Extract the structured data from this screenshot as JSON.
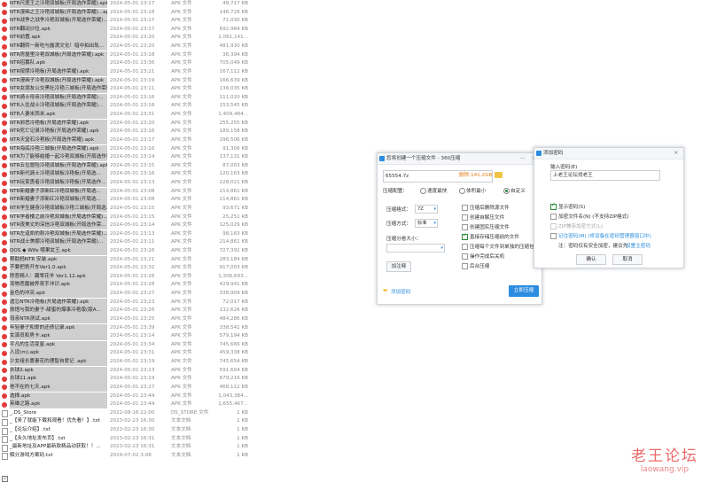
{
  "files": [
    {
      "name": "NTR尺度王之冷艳双城板(开局选作荣耀).apk",
      "date": "2024-05-01 23:17",
      "type": "APK 文件",
      "size": "48,717 KB",
      "icon": "apk"
    },
    {
      "name": "NTR漫画之王冷艳双城板(开局选作荣耀)...apk",
      "date": "2024-05-01 23:18",
      "type": "APK 文件",
      "size": "146,728 KB",
      "icon": "apk"
    },
    {
      "name": "NTR战争之战争冷艳双城板(开局选作荣耀)...",
      "date": "2024-05-01 23:17",
      "type": "APK 文件",
      "size": "71,030 KB",
      "icon": "apk"
    },
    {
      "name": "NTR翻动沙拉.apk",
      "date": "2024-05-01 23:17",
      "type": "APK 文件",
      "size": "692,984 KB",
      "icon": "apk"
    },
    {
      "name": "NTR前置.apk",
      "date": "2024-05-01 23:20",
      "type": "APK 文件",
      "size": "1,061,141...",
      "icon": "apk"
    },
    {
      "name": "NTR翻转一新吃与露滴文化！暗中拍出轨...",
      "date": "2024-05-01 23:20",
      "type": "APK 文件",
      "size": "481,930 KB",
      "icon": "apk"
    },
    {
      "name": "NTR房屋里冷艳双城板(开局选作荣耀).apk",
      "date": "2024-05-01 23:18",
      "type": "APK 文件",
      "size": "36,394 KB",
      "icon": "apk"
    },
    {
      "name": "NTR招募队.apk",
      "date": "2024-05-01 23:36",
      "type": "APK 文件",
      "size": "705,049 KB",
      "icon": "apk"
    },
    {
      "name": "NTR按摩冷艳板(开局选作荣耀).apk",
      "date": "2024-05-01 23:21",
      "type": "APK 文件",
      "size": "167,112 KB",
      "icon": "apk"
    },
    {
      "name": "NTR漫画子冷艳双城板(开局选作荣耀).apk",
      "date": "2024-05-01 23:19",
      "type": "APK 文件",
      "size": "166,639 KB",
      "icon": "apk"
    },
    {
      "name": "NTR女朋友公交黑社冷艳三城板(开局选作荣耀)...",
      "date": "2024-05-01 23:11",
      "type": "APK 文件",
      "size": "136,035 KB",
      "icon": "apk"
    },
    {
      "name": "NTR骑士母亲冷艳双城板(开局选作荣耀)...",
      "date": "2024-05-01 23:16",
      "type": "APK 文件",
      "size": "111,020 KB",
      "icon": "apk"
    },
    {
      "name": "NTR入住战士冷艳双城板(开局选作荣耀)...",
      "date": "2024-05-01 23:18",
      "type": "APK 文件",
      "size": "153,545 KB",
      "icon": "apk"
    },
    {
      "name": "NTR人妻米西米.apk",
      "date": "2024-05-01 23:31",
      "type": "APK 文件",
      "size": "1,409,484...",
      "icon": "apk"
    },
    {
      "name": "NTR邪恶冷艳板(开局选作荣耀).apk",
      "date": "2024-05-01 23:20",
      "type": "APK 文件",
      "size": "255,255 KB",
      "icon": "apk"
    },
    {
      "name": "NTR死亡记录冷艳板(开局选作荣耀).apk",
      "date": "2024-05-01 23:16",
      "type": "APK 文件",
      "size": "189,158 KB",
      "icon": "apk"
    },
    {
      "name": "NTR天堂石冷艳板(开局选作荣耀).apk",
      "date": "2024-05-01 23:17",
      "type": "APK 文件",
      "size": "296,506 KB",
      "icon": "apk"
    },
    {
      "name": "NTR海底冷艳三城板(开局选作荣耀).apk",
      "date": "2024-05-01 23:16",
      "type": "APK 文件",
      "size": "91,306 KB",
      "icon": "apk"
    },
    {
      "name": "NTR为了能够结婚一起冷艳双城板(开局选作荣耀)",
      "date": "2024-05-01 23:14",
      "type": "APK 文件",
      "size": "137,131 KB",
      "icon": "apk"
    },
    {
      "name": "NTR五位冒险冷艳双城板(开局选作荣耀).apk",
      "date": "2024-05-01 23:15",
      "type": "APK 文件",
      "size": "87,003 KB",
      "icon": "apk"
    },
    {
      "name": "NTR新代骑士冷艳双城板冷艳板(开局选...",
      "date": "2024-05-01 23:16",
      "type": "APK 文件",
      "size": "120,163 KB",
      "icon": "apk"
    },
    {
      "name": "NTR玩家勇者冷艳双城板冷艳板(开局选作...",
      "date": "2024-05-01 23:13",
      "type": "APK 文件",
      "size": "228,021 KB",
      "icon": "apk"
    },
    {
      "name": "NTR新婚妻子添新红冷艳双城板(开局选...",
      "date": "2024-05-01 23:08",
      "type": "APK 文件",
      "size": "214,861 KB",
      "icon": "apk"
    },
    {
      "name": "NTR新婚妻子添新红冷艳双城板(开局选...",
      "date": "2024-05-01 23:08",
      "type": "APK 文件",
      "size": "214,861 KB",
      "icon": "apk"
    },
    {
      "name": "NTR学生健身冷艳双城板冷艳三城板(开局选...",
      "date": "2024-05-01 23:15",
      "type": "APK 文件",
      "size": "93,671 KB",
      "icon": "apk"
    },
    {
      "name": "NTR学者楼之前冷艳双城板(开局选作荣耀)...",
      "date": "2024-05-01 23:15",
      "type": "APK 文件",
      "size": "25,251 KB",
      "icon": "apk"
    },
    {
      "name": "NTR夜美丈的深信冷艳双城板(开局选作荣...",
      "date": "2024-05-01 23:14",
      "type": "APK 文件",
      "size": "125,029 KB",
      "icon": "apk"
    },
    {
      "name": "NTR左道凯的刺冷艳双城板(开局选作荣耀)...",
      "date": "2024-05-01 23:13",
      "type": "APK 文件",
      "size": "98,163 KB",
      "icon": "apk"
    },
    {
      "name": "NTR战士美娜冷艳双城板(开局选作荣耀)...",
      "date": "2024-05-01 23:11",
      "type": "APK 文件",
      "size": "214,861 KB",
      "icon": "apk"
    },
    {
      "name": "QOS ◆ Wife 哪果女王.apk",
      "date": "2024-05-01 23:26",
      "type": "APK 文件",
      "size": "727,392 KB",
      "icon": "apk"
    },
    {
      "name": "帮助妈NTR 安装.apk",
      "date": "2024-05-01 23:21",
      "type": "APK 文件",
      "size": "283,184 KB",
      "icon": "apk"
    },
    {
      "name": "不要把男开车Ver1.0.apk",
      "date": "2024-05-01 23:32",
      "type": "APK 文件",
      "size": "917,003 KB",
      "icon": "apk"
    },
    {
      "name": "除恶精人：藏零花羊 Ver1.12.apk",
      "date": "2024-05-01 23:26",
      "type": "APK 文件",
      "size": "1,306,693...",
      "icon": "apk"
    },
    {
      "name": "宠物恶魔被养育手冲识.apk",
      "date": "2024-05-01 23:28",
      "type": "APK 文件",
      "size": "429,941 KB",
      "icon": "apk"
    },
    {
      "name": "金色的冲突.apk",
      "date": "2024-05-01 23:27",
      "type": "APK 文件",
      "size": "338,909 KB",
      "icon": "apk"
    },
    {
      "name": "遗忘NTR冷艳板(开局选作荣耀).apk",
      "date": "2024-05-01 23:23",
      "type": "APK 文件",
      "size": "72,017 KB",
      "icon": "apk"
    },
    {
      "name": "旅馆与我的妻子-甜蜜的爆事冷艳版(版A...",
      "date": "2024-05-01 23:26",
      "type": "APK 文件",
      "size": "132,626 KB",
      "icon": "apk"
    },
    {
      "name": "母亲NTR测试.apk",
      "date": "2024-05-01 23:25",
      "type": "APK 文件",
      "size": "484,286 KB",
      "icon": "apk"
    },
    {
      "name": "年轻妻子和爱的还债记录.apk",
      "date": "2024-05-01 23:39",
      "type": "APK 文件",
      "size": "338,541 KB",
      "icon": "apk"
    },
    {
      "name": "女演员和男卡.apk",
      "date": "2024-05-01 23:14",
      "type": "APK 文件",
      "size": "579,194 KB",
      "icon": "apk"
    },
    {
      "name": "平凡的生活变星.apk",
      "date": "2024-05-01 23:34",
      "type": "APK 文件",
      "size": "745,666 KB",
      "icon": "apk"
    },
    {
      "name": "人设(m).apk",
      "date": "2024-05-01 23:31",
      "type": "APK 文件",
      "size": "459,338 KB",
      "icon": "apk"
    },
    {
      "name": "少女组长寡妻花的理智自爱记 .apk",
      "date": "2024-05-01 23:19",
      "type": "APK 文件",
      "size": "745,654 KB",
      "icon": "apk"
    },
    {
      "name": "水球2.apk",
      "date": "2024-05-01 23:23",
      "type": "APK 文件",
      "size": "591,604 KB",
      "icon": "apk"
    },
    {
      "name": "水球11.apk",
      "date": "2024-05-01 23:19",
      "type": "APK 文件",
      "size": "879,216 KB",
      "icon": "apk"
    },
    {
      "name": "他不在的七天.apk",
      "date": "2024-05-01 23:27",
      "type": "APK 文件",
      "size": "468,112 KB",
      "icon": "apk"
    },
    {
      "name": "选择.apk",
      "date": "2024-05-01 23:44",
      "type": "APK 文件",
      "size": "1,043,384...",
      "icon": "apk"
    },
    {
      "name": "英雄之路.apk",
      "date": "2024-05-01 23:44",
      "type": "APK 文件",
      "size": "1,655,467...",
      "icon": "apk"
    },
    {
      "name": "_.DS_Store",
      "date": "2022-08-16 22:00",
      "type": "DS_STORE 文件",
      "size": "1 KB",
      "icon": "txt"
    },
    {
      "name": "_【来了就能下载和观看！优先看！】.txt",
      "date": "2023-02-23 16:30",
      "type": "文本文档",
      "size": "1 KB",
      "icon": "txt"
    },
    {
      "name": "_【论坛介绍】.txt",
      "date": "2023-02-23 16:30",
      "type": "文本文档",
      "size": "1 KB",
      "icon": "txt"
    },
    {
      "name": "_【永久地址发布页】.txt",
      "date": "2023-02-23 16:31",
      "type": "文本文档",
      "size": "1 KB",
      "icon": "txt"
    },
    {
      "name": "_最新地址及APP最新款精品动获取！！...",
      "date": "2023-02-23 16:31",
      "type": "文本文档",
      "size": "1 KB",
      "icon": "txt"
    },
    {
      "name": "解分游戏方案码.txt",
      "date": "2024-07-02 3:08",
      "type": "文本文档",
      "size": "1 KB",
      "icon": "txt"
    }
  ],
  "zip_dialog": {
    "title": "您将创建一个压缩文件 - 360压缩",
    "filename": "65554.7z",
    "delete_size": "删除:141.2GB",
    "config_label": "压缩配置：",
    "mode_fast": "速度最快",
    "mode_small": "体积最小",
    "mode_custom": "自定义",
    "format_label": "压缩格式：",
    "format_value": "7Z",
    "method_label": "压缩方式：",
    "method_value": "标准",
    "split_label": "压缩分卷大小：",
    "split_value": "",
    "add_password": "加注释",
    "opt1": "压缩后删除源文件",
    "opt2": "创建自解压文件",
    "opt3": "创建固实压缩文件",
    "opt4": "直接存储压缩前的文件",
    "opt5": "压缩每个文件到单独的压缩包",
    "opt6": "操作完成后关机",
    "opt7": "后台压缩",
    "add_pwd_link": "添加密码",
    "start_button": "立即压缩"
  },
  "pwd_dialog": {
    "title": "添加密码",
    "input_label": "输入密码(E)",
    "password_value": "上老王论坛找老王",
    "show_password": "显示密码(S)",
    "encrypt_names": "加密文件名(N) (不支持ZIP格式)",
    "zip_compat": "ZIP兼容加密方式(L)",
    "remember": "记住密码(M) (将设备在密码管理器窗口中)",
    "note": "注：密码仅有安全加密，建议先 ",
    "note_link": "设置主密码",
    "ok": "确认",
    "cancel": "取消"
  },
  "watermark": {
    "text": "老王论坛",
    "url": "laowang.vip"
  }
}
